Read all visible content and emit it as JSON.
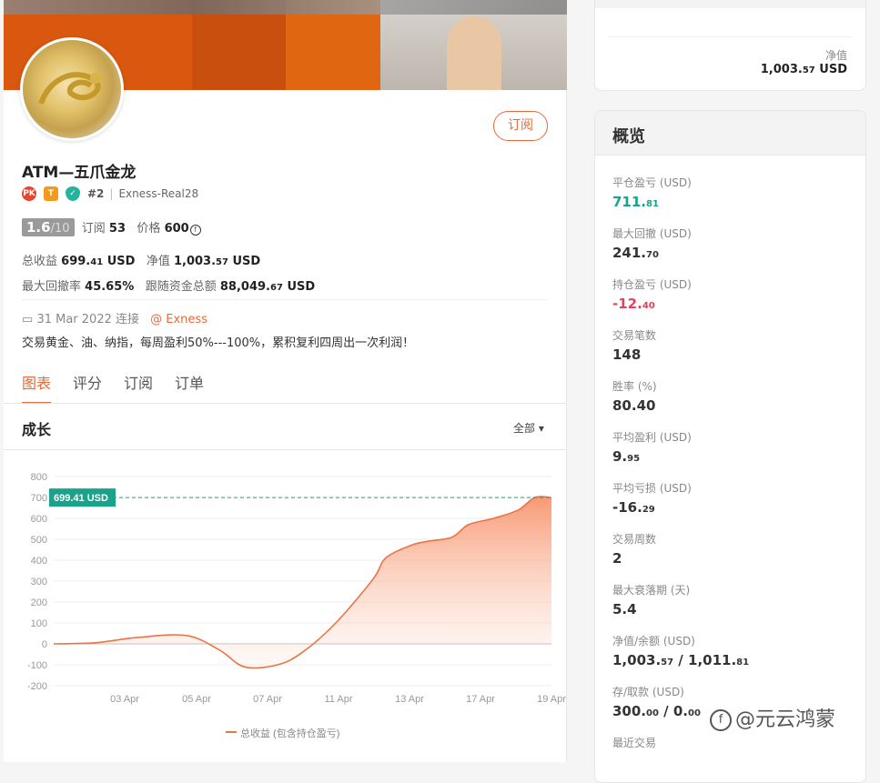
{
  "profile": {
    "subscribe_label": "订阅",
    "name": "ATM—五爪金龙",
    "badges": {
      "pk": "PK",
      "t": "T"
    },
    "rank": "#2",
    "account": "Exness-Real28",
    "score": "1.6",
    "score_max": "/10",
    "subscribe_count_label": "订阅",
    "subscribe_count": "53",
    "price_label": "价格",
    "price": "600",
    "total_profit_label": "总收益",
    "total_profit_main": "699.",
    "total_profit_dec": "41",
    "total_profit_unit": "USD",
    "equity_label": "净值",
    "equity_main": "1,003.",
    "equity_dec": "57",
    "equity_unit": "USD",
    "max_drawdown_label": "最大回撤率",
    "max_drawdown": "45.65%",
    "follow_funds_label": "跟随资金总额",
    "follow_funds_main": "88,049.",
    "follow_funds_dec": "67",
    "follow_funds_unit": "USD",
    "joined": "31 Mar 2022 连接",
    "broker": "@ Exness",
    "description": "交易黄金、油、纳指，每周盈利50%---100%，累积复利四周出一次利润！"
  },
  "tabs": [
    "图表",
    "评分",
    "订阅",
    "订单"
  ],
  "growth": {
    "title": "成长",
    "range": "全部",
    "legend": "总收益 (包含持仓盈亏)",
    "current_label": "699.41 USD"
  },
  "chart_data": {
    "type": "area",
    "x_ticks": [
      "03 Apr",
      "05 Apr",
      "07 Apr",
      "11 Apr",
      "13 Apr",
      "17 Apr",
      "19 Apr"
    ],
    "y_ticks": [
      800,
      700,
      600,
      500,
      400,
      300,
      200,
      100,
      0,
      -100,
      -200
    ],
    "ylim": [
      -200,
      800
    ],
    "series": [
      {
        "name": "总收益 (包含持仓盈亏)",
        "x": [
          0,
          0.5,
          1.0,
          1.6,
          2.0,
          2.3,
          2.7,
          3.0,
          3.4,
          3.85,
          4.0,
          4.3,
          4.5,
          4.8,
          5.0,
          5.3,
          5.6,
          5.8,
          6.0
        ],
        "y": [
          0,
          5,
          30,
          40,
          -30,
          -110,
          -100,
          -40,
          100,
          310,
          410,
          470,
          490,
          510,
          570,
          600,
          640,
          700,
          699.41
        ]
      }
    ],
    "reference_value": 699.41
  },
  "top_card": {
    "label": "净值",
    "value_main": "1,003.",
    "value_dec": "57",
    "value_unit": "USD"
  },
  "overview": {
    "title": "概览",
    "items": [
      {
        "label": "平仓盈亏 (USD)",
        "main": "711.",
        "dec": "81",
        "color": "#1aa38a"
      },
      {
        "label": "最大回撤 (USD)",
        "main": "241.",
        "dec": "70",
        "color": "#333333"
      },
      {
        "label": "持仓盈亏 (USD)",
        "main": "-12.",
        "dec": "40",
        "color": "#e0435a"
      },
      {
        "label": "交易笔数",
        "main": "148",
        "dec": "",
        "color": "#333333"
      },
      {
        "label": "胜率 (%)",
        "main": "80.40",
        "dec": "",
        "color": "#333333"
      },
      {
        "label": "平均盈利 (USD)",
        "main": "9.",
        "dec": "95",
        "color": "#333333"
      },
      {
        "label": "平均亏损 (USD)",
        "main": "-16.",
        "dec": "29",
        "color": "#333333"
      },
      {
        "label": "交易周数",
        "main": "2",
        "dec": "",
        "color": "#333333"
      },
      {
        "label": "最大衰落期 (天)",
        "main": "5.4",
        "dec": "",
        "color": "#333333"
      },
      {
        "label": "净值/余额 (USD)",
        "main": "1,003.",
        "dec": "57",
        "extra": " / 1,011.",
        "extra_dec": "81",
        "color": "#333333"
      },
      {
        "label": "存/取款 (USD)",
        "main": "300.",
        "dec": "00",
        "extra": " / 0.",
        "extra_dec": "00",
        "color": "#333333"
      },
      {
        "label": "最近交易",
        "main": "",
        "dec": "",
        "color": "#333333"
      }
    ]
  },
  "watermark": {
    "logo": "f",
    "text": "@元云鸿蒙"
  },
  "colors": {
    "accent": "#e86a3a",
    "green": "#1aa38a",
    "red": "#e0435a"
  }
}
